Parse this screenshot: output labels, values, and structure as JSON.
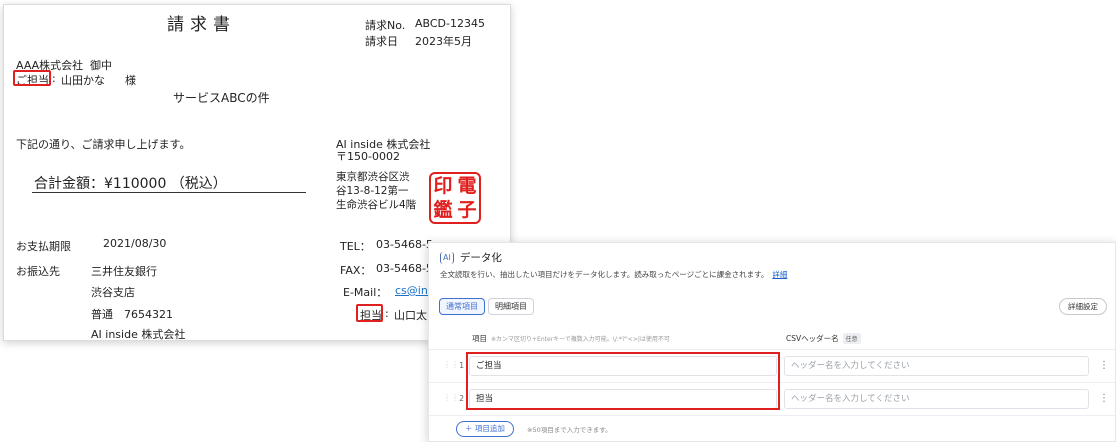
{
  "invoice": {
    "title": "請求書",
    "number_label": "請求No.",
    "number_value": "ABCD-12345",
    "date_label": "請求日",
    "date_value": "2023年5月",
    "client_company": "AAA株式会社",
    "client_honorific": "御中",
    "contact_label": "ご担当",
    "contact_sep": ":",
    "contact_name": "山田かな",
    "contact_honorific": "様",
    "subject": "サービスABCの件",
    "greeting": "下記の通り、ご請求申し上げます。",
    "total": "合計金額：¥110000 （税込）",
    "issuer": {
      "company": "AI inside 株式会社",
      "postal": "〒150-0002",
      "address_lines": [
        "東京都渋谷区渋",
        "谷13-8-12第一",
        "生命渋谷ビル4階"
      ],
      "tel_label": "TEL：",
      "tel_value": "03-5468-5",
      "fax_label": "FAX：",
      "fax_value": "03-5468-5",
      "email_label": "E-Mail：",
      "email_value": "cs@insi",
      "rep_label": "担当",
      "rep_sep": ":",
      "rep_value": "山口太郎"
    },
    "stamp_chars": [
      "印",
      "電",
      "鑑",
      "子"
    ],
    "payment": {
      "due_label": "お支払期限",
      "due_value": "2021/08/30",
      "transfer_label": "お振込先",
      "bank": "三井住友銀行",
      "branch": "渋谷支店",
      "account": "普通　7654321",
      "holder": "AI inside 株式会社"
    },
    "highlight_color": "#e0201f"
  },
  "panel": {
    "icon": "ai-icon",
    "icon_text": "AI",
    "title": "データ化",
    "description": "全文読取を行い、抽出したい項目だけをデータ化します。読み取ったページごとに課金されます。",
    "detail_link": "詳細",
    "tabs": [
      "通常項目",
      "明細項目"
    ],
    "settings_button": "詳細設定",
    "column_item": "項目",
    "column_item_note": "※カンマ区切り+Enterキーで複数入力可能。\\/:*?\"<>|は使用不可",
    "column_csv": "CSVヘッダー名",
    "optional_badge": "任意",
    "rows": [
      {
        "num": "1",
        "item": "ご担当",
        "csv_placeholder": "ヘッダー名を入力してください"
      },
      {
        "num": "2",
        "item": "担当",
        "csv_placeholder": "ヘッダー名を入力してください"
      }
    ],
    "add_button": "＋ 項目追加",
    "add_note": "※50項目まで入力できます。",
    "accent_color": "#3f6fd0"
  }
}
